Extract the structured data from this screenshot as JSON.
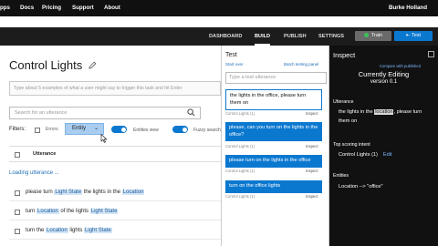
{
  "topbar": {
    "nav": [
      "pps",
      "Docs",
      "Pricing",
      "Support",
      "About"
    ],
    "user": "Burke Holland"
  },
  "appbar": {
    "tabs": [
      {
        "label": "DASHBOARD",
        "active": false
      },
      {
        "label": "BUILD",
        "active": true
      },
      {
        "label": "PUBLISH",
        "active": false
      },
      {
        "label": "SETTINGS",
        "active": false
      }
    ],
    "train_label": "Train",
    "test_label": "Test",
    "train_status_color": "#3cbf5a",
    "accent_color": "#0b78d0"
  },
  "main": {
    "title": "Control Lights",
    "utterance_placeholder": "Type about 5 examples of what a user might say to trigger this task and hit Enter",
    "search_placeholder": "Search for an utterance",
    "filters_label": "Filters:",
    "errors_label": "Errors",
    "entity_dropdown": "Entity",
    "entities_view_label": "Entities view",
    "fuzzy_search_label": "Fuzzy search",
    "table_header": "Utterance",
    "loading_text": "Loading utterance ...",
    "rows": [
      [
        {
          "t": "please turn ",
          "e": false
        },
        {
          "t": "Light State",
          "e": true
        },
        {
          "t": " the lights in the ",
          "e": false
        },
        {
          "t": "Location",
          "e": true
        }
      ],
      [
        {
          "t": "turn ",
          "e": false
        },
        {
          "t": "Location",
          "e": true
        },
        {
          "t": " of the lights ",
          "e": false
        },
        {
          "t": "Light State",
          "e": true
        }
      ],
      [
        {
          "t": "turn the ",
          "e": false
        },
        {
          "t": "Location",
          "e": true
        },
        {
          "t": " lights ",
          "e": false
        },
        {
          "t": "Light State",
          "e": true
        }
      ]
    ]
  },
  "test": {
    "title": "Test",
    "start_over": "Start over",
    "batch_panel": "Batch testing panel",
    "input_placeholder": "Type a test utterance",
    "items": [
      {
        "text": "the lights in the office, please turn them on",
        "meta": "Control Lights (1)",
        "inspect": "Inspect",
        "selected": true
      },
      {
        "text": "please, can you turn on the lights in the office?",
        "meta": "Control Lights (1)",
        "inspect": "Inspect",
        "selected": false
      },
      {
        "text": "please turn on the lights in the office",
        "meta": "Control Lights (1)",
        "inspect": "Inspect",
        "selected": false
      },
      {
        "text": "turn on the office lights",
        "meta": "Control Lights (1)",
        "inspect": "Inspect",
        "selected": false
      }
    ]
  },
  "inspect": {
    "title": "Inspect",
    "compare_link": "Compare with published",
    "currently_editing": "Currently Editing",
    "version": "version 0.1",
    "utterance_label": "Utterance",
    "utterance_parts": [
      {
        "t": "the lights in the ",
        "e": false
      },
      {
        "t": "location",
        "e": true
      },
      {
        "t": ", please turn",
        "e": false
      }
    ],
    "utterance_line2": "them on",
    "top_intent_label": "Top scoring intent",
    "top_intent": "Control Lights (1)",
    "edit_label": "Edit",
    "entities_label": "Entities",
    "entity_value": "Location --> \"office\""
  }
}
